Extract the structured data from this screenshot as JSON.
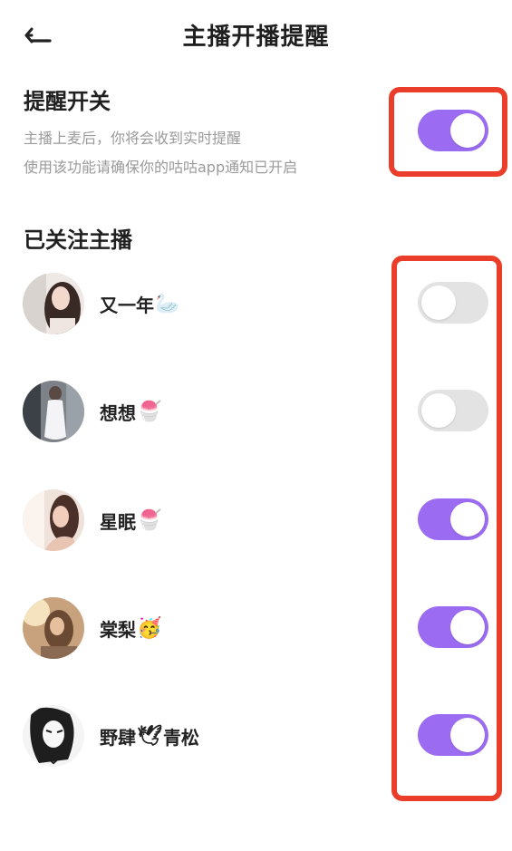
{
  "header": {
    "title": "主播开播提醒",
    "back_icon": "arrow-left-icon"
  },
  "reminder": {
    "title": "提醒开关",
    "desc_line1": "主播上麦后，你将会收到实时提醒",
    "desc_line2": "使用该功能请确保你的咕咕app通知已开启",
    "enabled": true
  },
  "followed": {
    "title": "已关注主播",
    "streamers": [
      {
        "name": "又一年",
        "emoji": "🦢",
        "enabled": false
      },
      {
        "name": "想想",
        "emoji": "🍧",
        "enabled": false
      },
      {
        "name": "星眠",
        "emoji": "🍧",
        "enabled": true
      },
      {
        "name": "棠梨",
        "emoji": "🥳",
        "enabled": true
      },
      {
        "name": "野肆",
        "emoji": "🕊",
        "name_suffix": "青松",
        "enabled": true
      }
    ]
  },
  "colors": {
    "toggle_on": "#9b6cf2",
    "toggle_off": "#e3e3e3",
    "highlight_box": "#ea3d2a"
  }
}
